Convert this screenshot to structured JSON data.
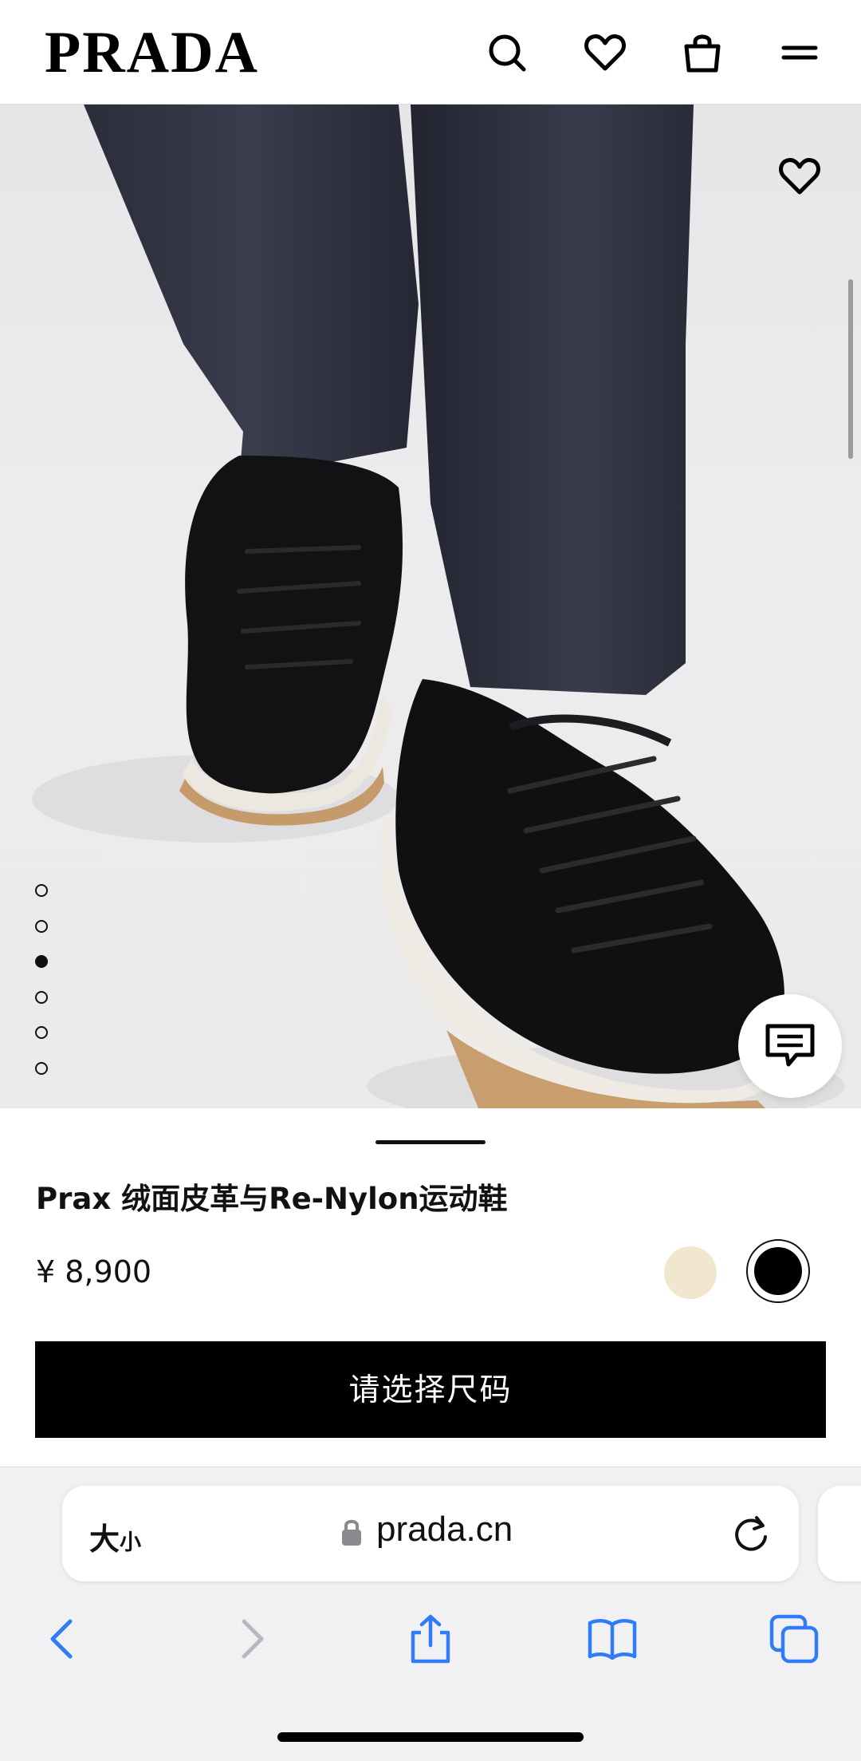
{
  "header": {
    "logo": "PRADA",
    "icons": [
      "search-icon",
      "heart-icon",
      "shopping-bag-icon",
      "menu-icon"
    ]
  },
  "gallery": {
    "slide_count": 6,
    "active_slide": 3
  },
  "product": {
    "title": "Prax 绒面皮革与Re-Nylon运动鞋",
    "price": "¥ 8,900",
    "colors": [
      {
        "name": "beige",
        "hex": "#f1e7cf",
        "selected": false
      },
      {
        "name": "black",
        "hex": "#000000",
        "selected": true
      }
    ],
    "cta_label": "请选择尺码"
  },
  "browser": {
    "text_size_label_big": "大",
    "text_size_label_small": "小",
    "url": "prada.cn"
  },
  "colors": {
    "brand": "#000000",
    "background": "#ffffff",
    "hero_background": "#ebebec",
    "safari_blue": "#2f7cf6"
  }
}
